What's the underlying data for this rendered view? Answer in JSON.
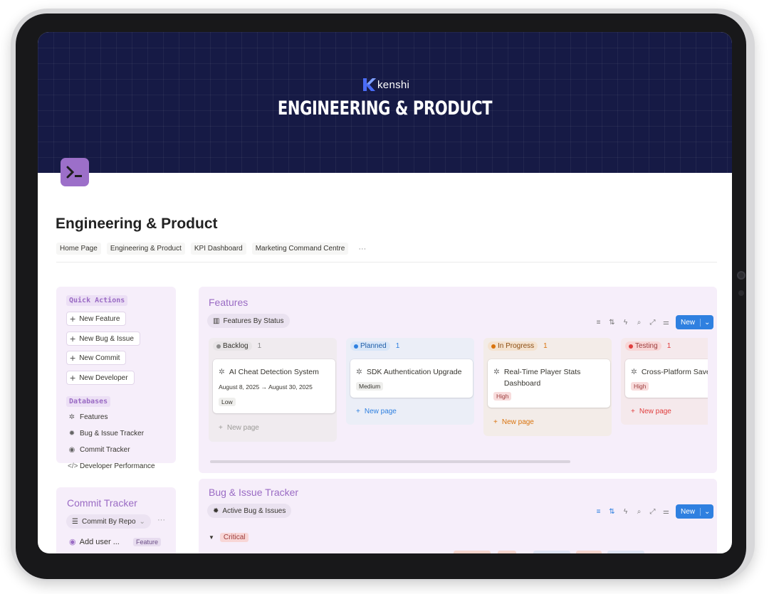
{
  "cover": {
    "brand": "kenshi",
    "title": "ENGINEERING & PRODUCT"
  },
  "page": {
    "title": "Engineering & Product"
  },
  "breadcrumbs": [
    "Home Page",
    "Engineering & Product",
    "KPI Dashboard",
    "Marketing Command Centre"
  ],
  "breadcrumb_more": "···",
  "quick_actions": {
    "label": "Quick Actions",
    "buttons": [
      "New Feature",
      "New Bug & Issue",
      "New Commit",
      "New Developer"
    ]
  },
  "databases": {
    "label": "Databases",
    "items": [
      {
        "label": "Features",
        "icon": "bug-outline-icon"
      },
      {
        "label": "Bug & Issue Tracker",
        "icon": "bug-icon"
      },
      {
        "label": "Commit Tracker",
        "icon": "commit-icon"
      },
      {
        "label": "Developer Performance",
        "icon": "code-icon"
      }
    ]
  },
  "commit_tracker": {
    "title": "Commit Tracker",
    "view": "Commit By Repo",
    "more": "···",
    "row_label": "Add user ...",
    "row_badge": "Feature"
  },
  "features": {
    "title": "Features",
    "view": "Features By Status",
    "new_label": "New",
    "new_page": "New page",
    "columns": [
      {
        "status": "Backlog",
        "count": "1",
        "color": "#8c8c8c",
        "card": {
          "title": "AI Cheat Detection System",
          "date": "August 8, 2025 → August 30, 2025",
          "priority": "Low"
        }
      },
      {
        "status": "Planned",
        "count": "1",
        "color": "#2f80e0",
        "card": {
          "title": "SDK Authentication Upgrade",
          "priority": "Medium"
        }
      },
      {
        "status": "In Progress",
        "count": "1",
        "color": "#d9730d",
        "card": {
          "title": "Real-Time Player Stats Dashboard",
          "priority": "High"
        }
      },
      {
        "status": "Testing",
        "count": "1",
        "color": "#e03e3e",
        "card": {
          "title": "Cross-Platform Save",
          "priority": "High"
        }
      }
    ]
  },
  "bugs": {
    "title": "Bug & Issue Tracker",
    "view": "Active Bug & Issues",
    "new_label": "New",
    "group": "Critical"
  }
}
